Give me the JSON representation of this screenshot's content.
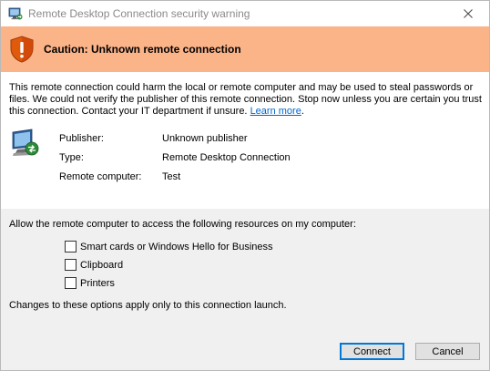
{
  "window": {
    "title": "Remote Desktop Connection security warning"
  },
  "banner": {
    "title": "Caution: Unknown remote connection",
    "color": "#fbb388"
  },
  "warning": {
    "text": "This remote connection could harm the local or remote computer and may be used to steal passwords or files. We could not verify the publisher of this remote connection. Stop now unless you are certain you trust this connection. Contact your IT department if unsure.",
    "link_label": "Learn more",
    "link_suffix": "."
  },
  "info": {
    "publisher_label": "Publisher:",
    "publisher_value": "Unknown publisher",
    "type_label": "Type:",
    "type_value": "Remote Desktop Connection",
    "computer_label": "Remote computer:",
    "computer_value": "Test"
  },
  "resources": {
    "label": "Allow the remote computer to access the following resources on my computer:",
    "options": [
      {
        "label": "Smart cards or Windows Hello for Business",
        "checked": false
      },
      {
        "label": "Clipboard",
        "checked": false
      },
      {
        "label": "Printers",
        "checked": false
      }
    ],
    "note": "Changes to these options apply only to this connection launch."
  },
  "buttons": {
    "connect": "Connect",
    "cancel": "Cancel"
  },
  "icons": {
    "title_icon": "remote-desktop-icon",
    "banner_icon": "warning-shield-icon",
    "computer_icon": "remote-computer-icon",
    "close_icon": "close-icon"
  },
  "colors": {
    "link": "#0066cc",
    "default_button_border": "#0078d7"
  }
}
